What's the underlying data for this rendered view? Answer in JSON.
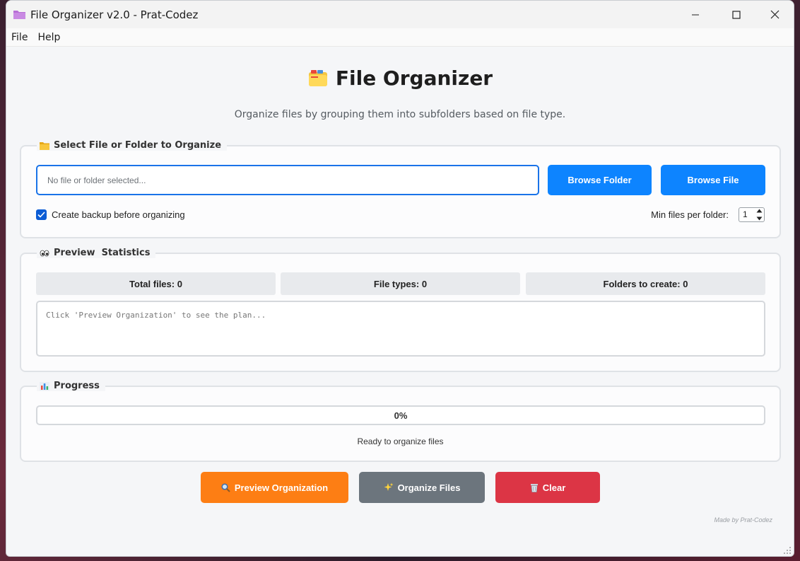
{
  "window": {
    "title": "File Organizer v2.0 - Prat-Codez",
    "icon": "folder-icon"
  },
  "menu": {
    "items": [
      "File",
      "Help"
    ]
  },
  "header": {
    "title": "File Organizer",
    "icon": "card-index-dividers-icon",
    "subtitle": "Organize files by grouping them into subfolders based on file type."
  },
  "select_group": {
    "title": "Select File or Folder to Organize",
    "icon": "folder-icon",
    "path_placeholder": "No file or folder selected...",
    "path_value": "",
    "browse_folder_label": "Browse Folder",
    "browse_file_label": "Browse File",
    "backup_label": "Create backup before organizing",
    "backup_checked": true,
    "min_files_label": "Min files per folder:",
    "min_files_value": "1"
  },
  "stats_group": {
    "title": "Preview  Statistics",
    "icon": "eyes-icon",
    "total_files": "Total files: 0",
    "file_types": "File types: 0",
    "folders_to_create": "Folders to create: 0",
    "preview_text": "Click 'Preview Organization' to see the plan..."
  },
  "progress_group": {
    "title": "Progress",
    "icon": "bar-chart-icon",
    "percent_label": "0%",
    "percent_value": 0,
    "status": "Ready to organize files"
  },
  "actions": {
    "preview_label": "Preview Organization",
    "organize_label": "Organize Files",
    "clear_label": "Clear"
  },
  "credit": "Made by Prat-Codez",
  "colors": {
    "accent_blue": "#0d84ff",
    "preview_orange": "#fd7e14",
    "organize_gray": "#6c757d",
    "clear_red": "#dc3545",
    "checkbox_blue": "#0b5cd5"
  }
}
